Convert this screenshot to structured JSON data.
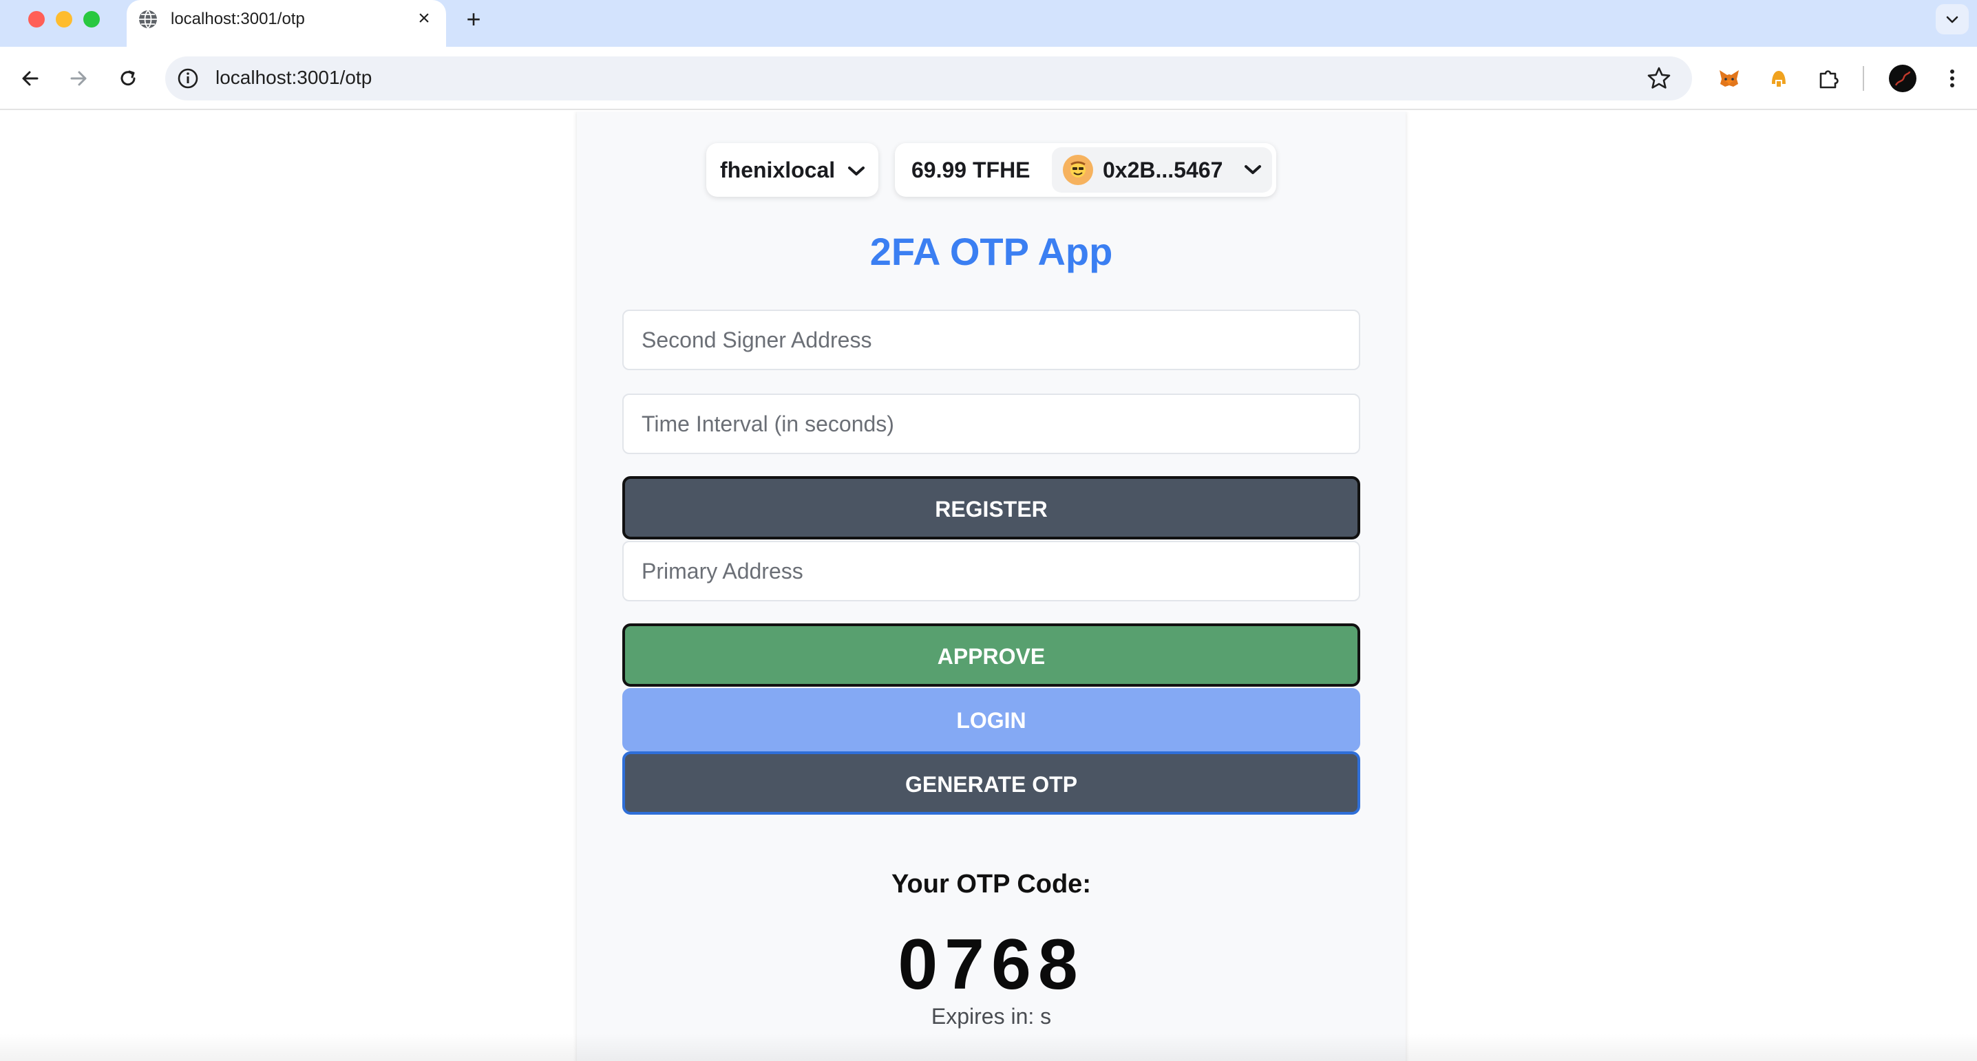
{
  "browser": {
    "tab_title": "localhost:3001/otp",
    "url": "localhost:3001/otp",
    "new_tab": "+",
    "tab_close": "×"
  },
  "wallet": {
    "network": "fhenixlocal",
    "balance": "69.99 TFHE",
    "address": "0x2B...5467"
  },
  "app": {
    "title": "2FA OTP App",
    "second_signer_placeholder": "Second Signer Address",
    "time_interval_placeholder": "Time Interval (in seconds)",
    "register_label": "REGISTER",
    "primary_address_placeholder": "Primary Address",
    "approve_label": "APPROVE",
    "login_label": "LOGIN",
    "generate_label": "GENERATE OTP",
    "otp_heading": "Your OTP Code:",
    "otp_code": "0768",
    "expires_text": "Expires in: s"
  },
  "colors": {
    "title_blue": "#3b7ff2",
    "register_bg": "#4b5563",
    "approve_bg": "#58a06f",
    "login_bg": "#84a9f4",
    "generate_bg": "#4b5563",
    "tabstrip_bg": "#d3e3fd"
  },
  "icons": [
    "globe-icon",
    "close-icon",
    "plus-icon",
    "chevron-down-icon",
    "back-arrow-icon",
    "forward-arrow-icon",
    "reload-icon",
    "info-icon",
    "star-icon",
    "metamask-fox-icon",
    "helmet-extension-icon",
    "puzzle-extensions-icon",
    "profile-avatar",
    "kebab-menu-icon"
  ]
}
